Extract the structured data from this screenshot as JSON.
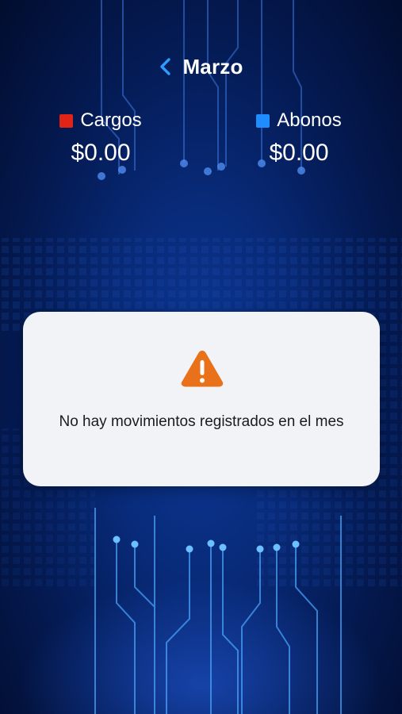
{
  "header": {
    "title": "Marzo",
    "back_icon": "chevron-left-icon",
    "back_color": "#2f9bff"
  },
  "summary": {
    "cargos": {
      "label": "Cargos",
      "value": "$0.00",
      "color": "#e02418"
    },
    "abonos": {
      "label": "Abonos",
      "value": "$0.00",
      "color": "#1f8cff"
    }
  },
  "empty_state": {
    "icon": "warning-icon",
    "icon_color": "#e8711a",
    "message": "No hay movimientos registrados en el mes"
  }
}
